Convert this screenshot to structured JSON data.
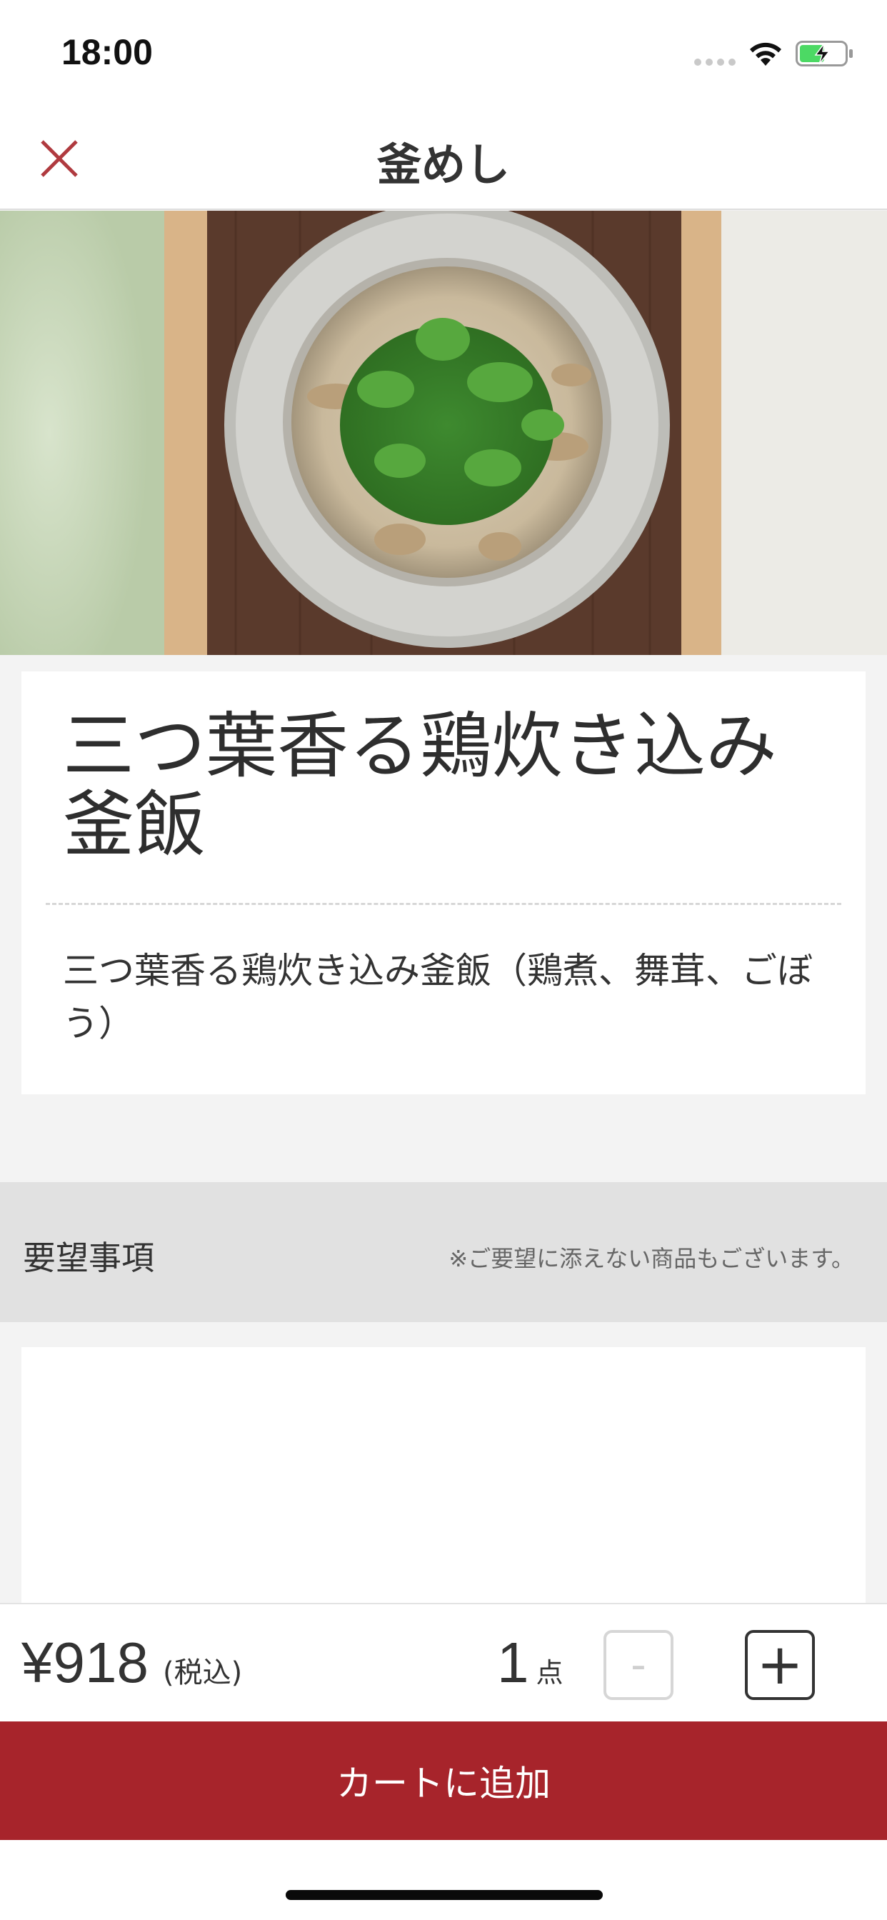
{
  "status_bar": {
    "time": "18:00",
    "icons": [
      "cellular-signal-icon",
      "wifi-icon",
      "battery-charging-icon"
    ]
  },
  "header": {
    "title": "釜めし",
    "close_icon": "close-icon"
  },
  "hero": {
    "image": "kamameshi-photo"
  },
  "item": {
    "name": "三つ葉香る鶏炊き込み釜飯",
    "description": "三つ葉香る鶏炊き込み釜飯（鶏煮、舞茸、ごぼう）"
  },
  "requests": {
    "label": "要望事項",
    "note": "※ご要望に添えない商品もございます。",
    "value": "",
    "placeholder": ""
  },
  "order": {
    "price": "¥918",
    "tax_label": "(税込)",
    "quantity": "1",
    "quantity_unit": "点",
    "minus_label": "-",
    "plus_label": "+"
  },
  "cart": {
    "button_label": "カートに追加"
  },
  "colors": {
    "accent": "#a7242b",
    "background": "#f3f3f3",
    "section_header": "#e1e1e1",
    "text": "#333333"
  }
}
